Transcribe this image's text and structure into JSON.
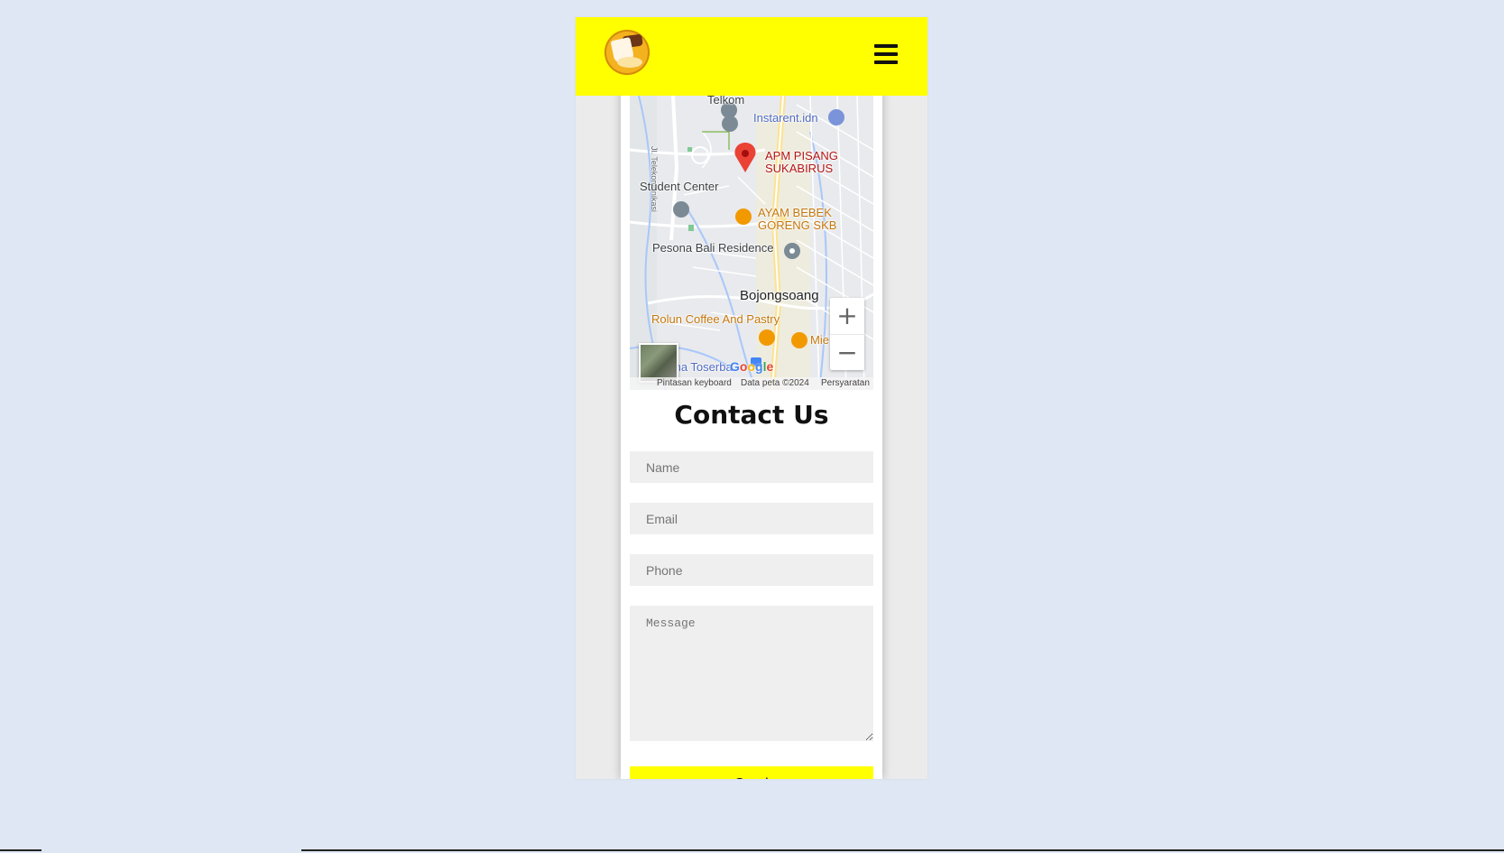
{
  "navbar": {
    "menu_icon": "hamburger-menu-icon",
    "background": "#ffff00"
  },
  "map": {
    "labels": {
      "telkom": "Telkom",
      "instarent": "Instarent.idn",
      "road": "Jl. Telekomunikasi",
      "apm_line1": "APM PISANG",
      "apm_line2": "SUKABIRUS",
      "student_center": "Student Center",
      "ayam_line1": "AYAM BEBEK",
      "ayam_line2": "GORENG SKB",
      "pesona": "Pesona Bali Residence",
      "bojongsoang": "Bojongsoang",
      "rolun": "Rolun Coffee And Pastry",
      "mie": "Mie",
      "toserba": "ma Toserba",
      "google": "Google"
    },
    "zoom_in": "+",
    "zoom_out": "−",
    "attribution": {
      "shortcuts": "Pintasan keyboard",
      "data": "Data peta ©2024",
      "terms": "Persyaratan"
    }
  },
  "contact": {
    "title": "Contact Us",
    "name_placeholder": "Name",
    "email_placeholder": "Email",
    "phone_placeholder": "Phone",
    "message_placeholder": "Message",
    "send_label": "Send"
  }
}
